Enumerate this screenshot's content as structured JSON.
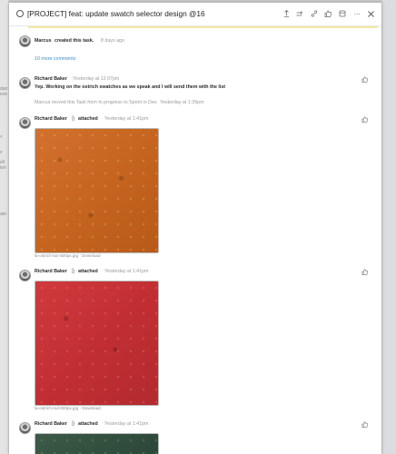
{
  "backdrop": {
    "left_marks": [
      "dan",
      "eve",
      "<",
      "v",
      "ell",
      "ion",
      "ate"
    ]
  },
  "header": {
    "title": "[PROJECT] feat: update swatch selector design @16",
    "icons": [
      "upload-icon",
      "move-icon",
      "link-icon",
      "like-icon",
      "archive-icon",
      "more-icon",
      "close-icon"
    ],
    "accent_color": "#f3e8a0"
  },
  "feed": {
    "created": {
      "user": "Marcus",
      "action": "created this task.",
      "time": "8 days ago"
    },
    "more_comments": "10 more comments",
    "comment": {
      "user": "Richard Baker",
      "time": "Yesterday at 12:07pm",
      "text": "Yep. Working on the ostrich swatches as we speak and I will send them with the list",
      "system_text": "Marcus moved this Task from In progress to Sprint in Dev.",
      "system_time": "Yesterday at 1:39pm"
    },
    "attachments": [
      {
        "user": "Richard Baker",
        "action": "attached",
        "time": "Yesterday at 1:41pm",
        "filename": "la-ostrich-tan-600px.jpg",
        "separator": " · ",
        "download": "Download",
        "swatch_color": "#c96a25"
      },
      {
        "user": "Richard Baker",
        "action": "attached",
        "time": "Yesterday at 1:41pm",
        "filename": "la-ostrich-red-600px.jpg",
        "separator": " · ",
        "download": "Download",
        "swatch_color": "#c63235"
      },
      {
        "user": "Richard Baker",
        "action": "attached",
        "time": "Yesterday at 1:41pm",
        "swatch_color": "#35523f"
      }
    ],
    "colors": {
      "link": "#3a8fcf",
      "muted": "#9a9a9a"
    }
  }
}
